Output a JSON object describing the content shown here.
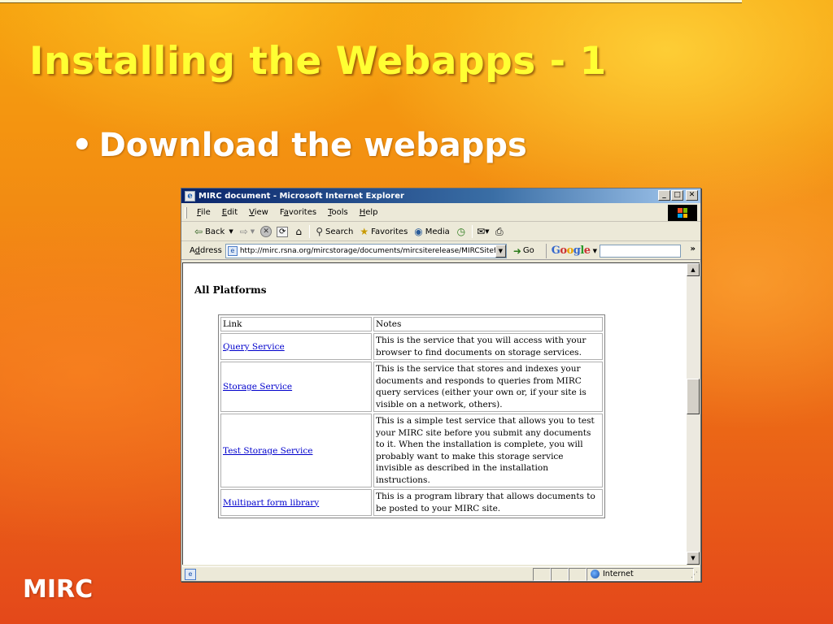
{
  "slide": {
    "title": "Installing the Webapps - 1",
    "bullet": "Download the webapps",
    "footer_brand": "MIRC"
  },
  "browser": {
    "window_title": "MIRC document - Microsoft Internet Explorer",
    "menu": [
      {
        "pre": "",
        "key": "F",
        "post": "ile"
      },
      {
        "pre": "",
        "key": "E",
        "post": "dit"
      },
      {
        "pre": "",
        "key": "V",
        "post": "iew"
      },
      {
        "pre": "F",
        "key": "a",
        "post": "vorites"
      },
      {
        "pre": "",
        "key": "T",
        "post": "ools"
      },
      {
        "pre": "",
        "key": "H",
        "post": "elp"
      }
    ],
    "toolbar": {
      "back_label": "Back",
      "search_label": "Search",
      "favorites_label": "Favorites",
      "media_label": "Media"
    },
    "address": {
      "label_pre": "A",
      "label_key": "d",
      "label_post": "dress",
      "url": "http://mirc.rsna.org/mircstorage/documents/mircsiterelease/MIRCSitef",
      "go_label": "Go"
    },
    "google": {
      "g1": "G",
      "g2": "o",
      "g3": "o",
      "g4": "g",
      "g5": "l",
      "g6": "e"
    },
    "status": {
      "zone_label": "Internet"
    }
  },
  "document": {
    "heading": "All Platforms",
    "table": {
      "header": {
        "link": "Link",
        "notes": "Notes"
      },
      "rows": [
        {
          "link": "Query Service",
          "notes": "This is the service that you will access with your browser to find documents on storage services."
        },
        {
          "link": "Storage Service",
          "notes": "This is the service that stores and indexes your documents and responds to queries from MIRC query services (either your own or, if your site is visible on a network, others)."
        },
        {
          "link": "Test Storage Service",
          "notes": "This is a simple test service that allows you to test your MIRC site before you submit any documents to it. When the installation is complete, you will probably want to make this storage service invisible as described in the installation instructions."
        },
        {
          "link": "Multipart form library",
          "notes": "This is a program library that allows documents to be posted to your MIRC site."
        }
      ]
    }
  }
}
